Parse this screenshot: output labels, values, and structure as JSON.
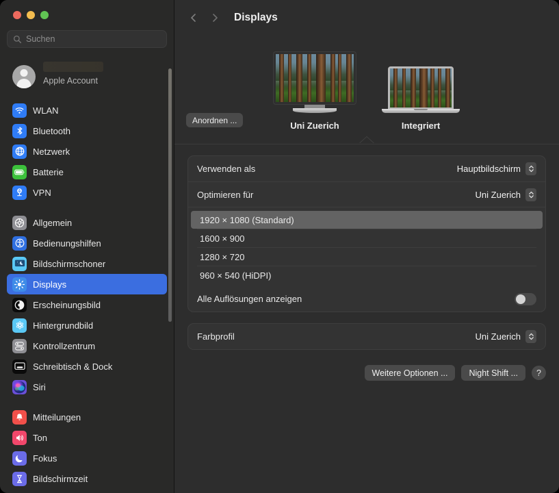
{
  "window": {
    "traffic_lights": [
      "close",
      "minimize",
      "zoom"
    ],
    "colors": {
      "accent": "#3b6ee0",
      "sidebar_bg": "#292928",
      "main_bg": "#2d2d2d",
      "card_bg": "#333333"
    }
  },
  "sidebar": {
    "search": {
      "placeholder": "Suchen",
      "value": "",
      "icon": "search-icon"
    },
    "account": {
      "label": "Apple Account",
      "avatar_icon": "person-avatar-icon"
    },
    "groups": [
      {
        "items": [
          {
            "label": "WLAN",
            "icon": "wifi-icon",
            "color": "#2f7cf6"
          },
          {
            "label": "Bluetooth",
            "icon": "bluetooth-icon",
            "color": "#2f7cf6"
          },
          {
            "label": "Netzwerk",
            "icon": "globe-icon",
            "color": "#2f7cf6"
          },
          {
            "label": "Batterie",
            "icon": "battery-icon",
            "color": "#3cc13b"
          },
          {
            "label": "VPN",
            "icon": "vpn-icon",
            "color": "#2f7cf6"
          }
        ]
      },
      {
        "items": [
          {
            "label": "Allgemein",
            "icon": "gear-icon",
            "color": "#8e8e93"
          },
          {
            "label": "Bedienungshilfen",
            "icon": "accessibility-icon",
            "color": "#2f6fe0"
          },
          {
            "label": "Bildschirmschoner",
            "icon": "screensaver-icon",
            "color": "#5ac8f5"
          },
          {
            "label": "Displays",
            "icon": "brightness-icon",
            "color": "#3f8ce8",
            "selected": true
          },
          {
            "label": "Erscheinungsbild",
            "icon": "appearance-icon",
            "color": "#0b0b0b"
          },
          {
            "label": "Hintergrundbild",
            "icon": "wallpaper-icon",
            "color": "#5ac8f5"
          },
          {
            "label": "Kontrollzentrum",
            "icon": "control-center-icon",
            "color": "#8e8e93"
          },
          {
            "label": "Schreibtisch & Dock",
            "icon": "desktop-dock-icon",
            "color": "#0b0b0b"
          },
          {
            "label": "Siri",
            "icon": "siri-icon",
            "color": "#6b4fd8"
          }
        ]
      },
      {
        "items": [
          {
            "label": "Mitteilungen",
            "icon": "notifications-icon",
            "color": "#f1504a"
          },
          {
            "label": "Ton",
            "icon": "sound-icon",
            "color": "#f2476b"
          },
          {
            "label": "Fokus",
            "icon": "focus-moon-icon",
            "color": "#6b6ce8"
          },
          {
            "label": "Bildschirmzeit",
            "icon": "screen-time-icon",
            "color": "#6b6ce8"
          }
        ]
      }
    ],
    "scrollbar": {
      "name": "sidebar-scrollbar"
    }
  },
  "header": {
    "back_icon": "chevron-left-icon",
    "forward_icon": "chevron-right-icon",
    "title": "Displays"
  },
  "displays": {
    "arrange_button": "Anordnen ...",
    "items": [
      {
        "name": "Uni Zuerich",
        "type": "external-monitor",
        "selected": true
      },
      {
        "name": "Integriert",
        "type": "built-in-laptop",
        "selected": false
      }
    ]
  },
  "settings": {
    "use_as": {
      "label": "Verwenden als",
      "value": "Hauptbildschirm"
    },
    "optimize_for": {
      "label": "Optimieren für",
      "value": "Uni Zuerich"
    },
    "resolutions": [
      {
        "label": "1920 × 1080 (Standard)",
        "selected": true
      },
      {
        "label": "1600 × 900",
        "selected": false
      },
      {
        "label": "1280 × 720",
        "selected": false
      },
      {
        "label": "960 × 540 (HiDPI)",
        "selected": false
      }
    ],
    "show_all": {
      "label": "Alle Auflösungen anzeigen",
      "value": "off"
    },
    "color_profile": {
      "label": "Farbprofil",
      "value": "Uni Zuerich"
    }
  },
  "footer": {
    "more_options": "Weitere Optionen ...",
    "night_shift": "Night Shift ...",
    "help": "?"
  }
}
